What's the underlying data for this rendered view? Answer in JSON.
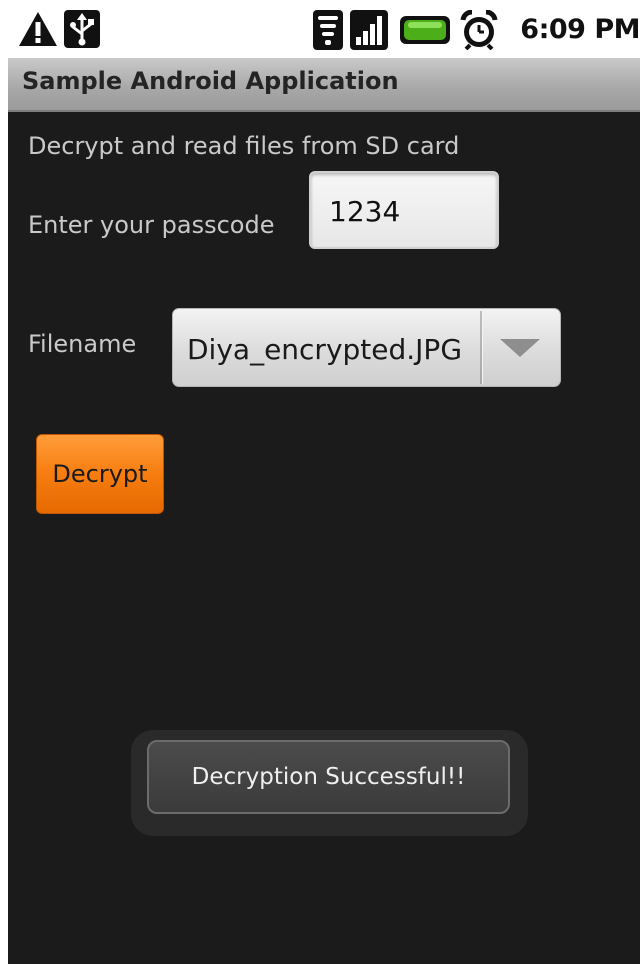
{
  "status_bar": {
    "icons": [
      "warning-icon",
      "usb-icon",
      "wifi-icon",
      "signal-icon",
      "battery-icon",
      "alarm-icon"
    ],
    "time": "6:09 PM"
  },
  "title_bar": {
    "title": "Sample Android Application"
  },
  "main": {
    "description": "Decrypt and read files from SD card",
    "passcode_label": "Enter your passcode",
    "passcode_value": "1234",
    "filename_label": "Filename",
    "filename_selected": "Diya_encrypted.JPG",
    "decrypt_button": "Decrypt"
  },
  "toast": {
    "message": "Decryption Successful!!"
  },
  "colors": {
    "background": "#1b1b1b",
    "accent_button": "#f77d10",
    "battery": "#4caf1a"
  }
}
